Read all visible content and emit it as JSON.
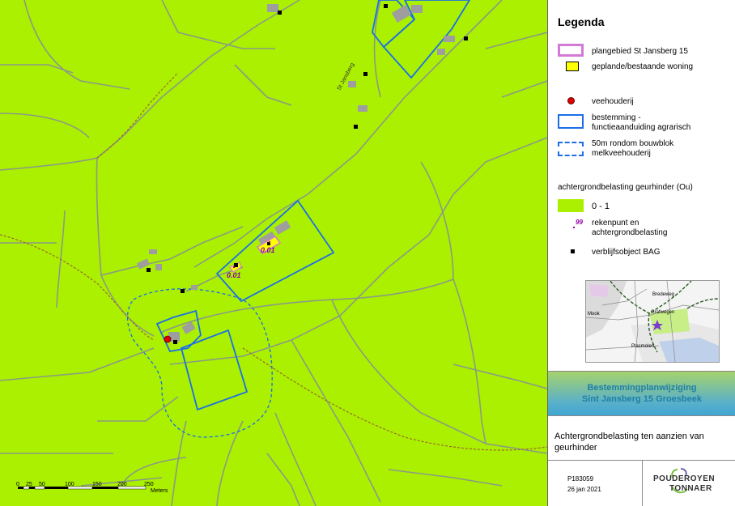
{
  "colors": {
    "background_fill": "#aaf000",
    "road": "#8a9a86",
    "plan_area_border": "#d27ad6",
    "dwelling_fill": "#ffff00",
    "livestock_farm": "#e00000",
    "agri_border": "#1a6fe8",
    "buffer_border": "#1a6fe8",
    "calc_point": "#8e00a8",
    "building": "#9e9e9e"
  },
  "map": {
    "street_label": "St Jansberg",
    "calc_points": [
      {
        "value": "0.01"
      },
      {
        "value": "0.01"
      }
    ],
    "scale_bar": {
      "ticks": [
        "0",
        "25",
        "50",
        "100",
        "150",
        "200",
        "250"
      ],
      "unit": "Meters"
    }
  },
  "legend": {
    "title": "Legenda",
    "items": [
      {
        "icon": "plan-area-swatch",
        "label": "plangebied St Jansberg 15"
      },
      {
        "icon": "dwelling-swatch",
        "label": "geplande/bestaande woning"
      },
      {
        "icon": "livestock-farm-icon",
        "label": "veehouderij"
      },
      {
        "icon": "agri-zoning-swatch",
        "label_line1": "bestemming -",
        "label_line2": "functieaanduiding agrarisch"
      },
      {
        "icon": "buffer-swatch",
        "label_line1": "50m rondom bouwblok",
        "label_line2": "melkveehouderij"
      }
    ],
    "odour_heading": "achtergrondbelasting geurhinder (Ou)",
    "odour_classes": [
      {
        "label": "0 - 1"
      }
    ],
    "calc_point_item": {
      "sample": "99",
      "label_line1": "rekenpunt en",
      "label_line2": "achtergrondbelasting"
    },
    "bag_item": {
      "label": "verblijfsobject BAG"
    },
    "inset_map": {
      "labels": [
        "Bredeweg",
        "Grafwegen",
        "Mook",
        "Plasmolen"
      ]
    }
  },
  "title_block": {
    "line1": "Bestemmingplanwijziging",
    "line2": "Sint Jansberg 15 Groesbeek"
  },
  "subtitle": "Achtergrondbelasting ten aanzien van geurhinder",
  "footer": {
    "project_no": "P183059",
    "date": "26 jan 2021",
    "logo_line1": "POUDEROYEN",
    "logo_line2": "TONNAER"
  }
}
